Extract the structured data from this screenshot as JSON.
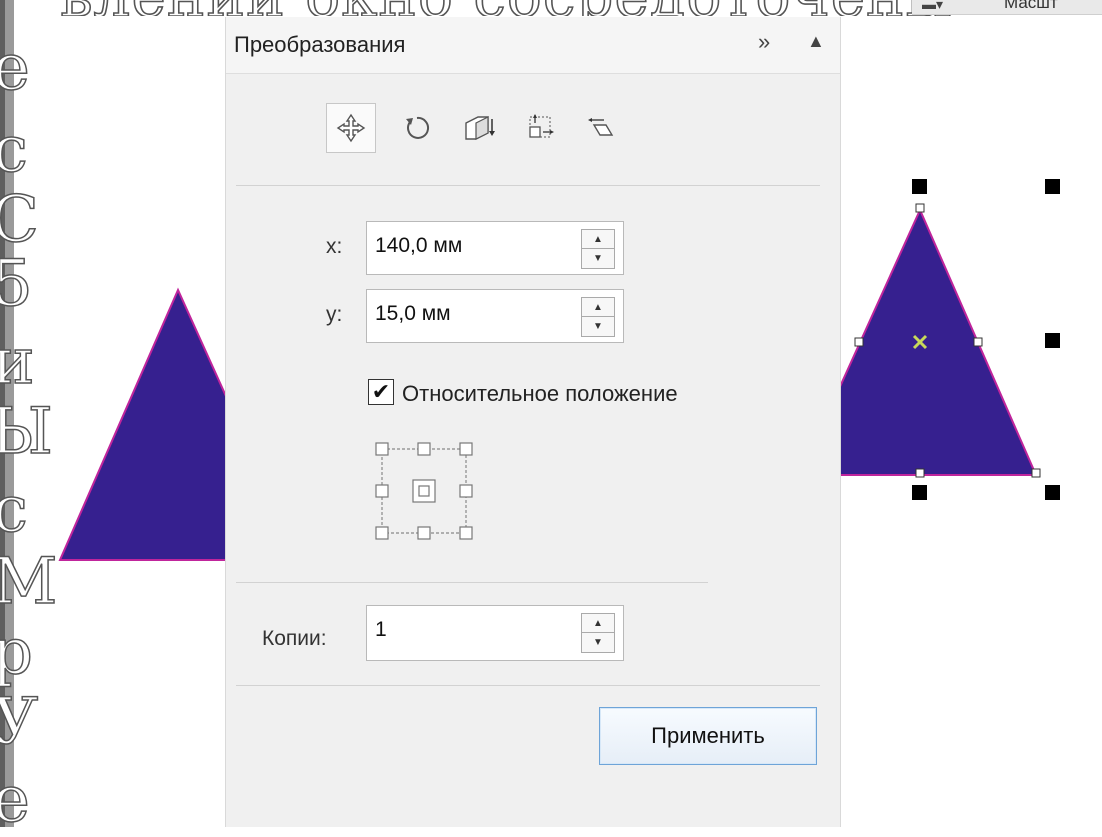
{
  "slide": {
    "top_text": "влении окно сосредоточены",
    "left_glyphs": [
      "е",
      "с",
      "С",
      "5",
      "и",
      "Ы",
      "с",
      "М",
      "р",
      "У",
      "е"
    ]
  },
  "toolbar_right": {
    "label": "Масшт"
  },
  "panel": {
    "title": "Преобразования",
    "expand_icon": "double-chevron-right-icon",
    "collapse_icon": "triangle-up-icon",
    "tools": [
      {
        "name": "position",
        "icon": "move-cross-icon",
        "active": true
      },
      {
        "name": "rotate",
        "icon": "rotate-icon",
        "active": false
      },
      {
        "name": "scale-mirror",
        "icon": "scale-mirror-icon",
        "active": false
      },
      {
        "name": "size",
        "icon": "size-icon",
        "active": false
      },
      {
        "name": "skew",
        "icon": "skew-icon",
        "active": false
      }
    ],
    "x_label": "x:",
    "x_value": "140,0 мм",
    "y_label": "y:",
    "y_value": "15,0 мм",
    "relative_position_label": "Относительное положение",
    "relative_position_checked": true,
    "copies_label": "Копии:",
    "copies_value": "1",
    "apply_label": "Применить"
  },
  "colors": {
    "triangle_fill": "#36208f",
    "triangle_stroke": "#c0259c",
    "panel_bg": "#f0f0f0",
    "selection_center": "#c8d95a"
  }
}
